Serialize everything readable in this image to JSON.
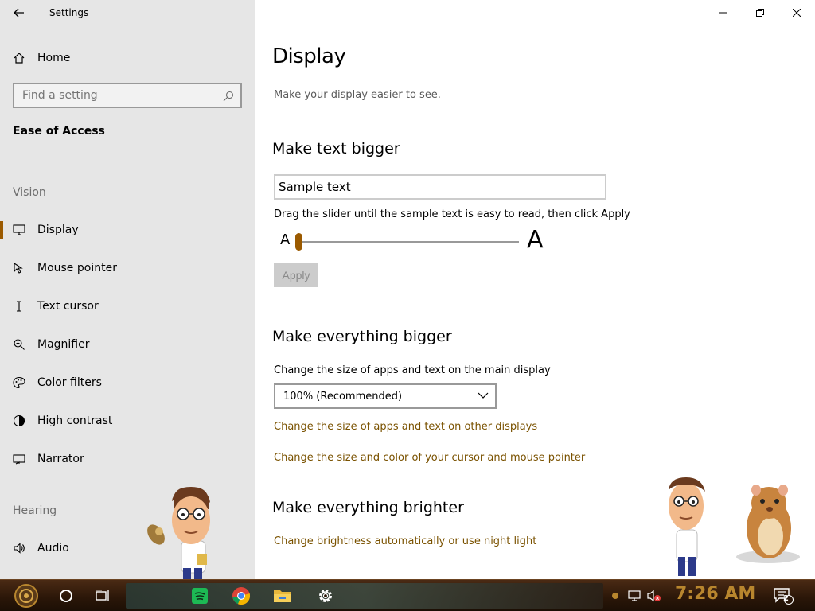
{
  "window": {
    "title": "Settings",
    "accent_color": "#9b5a00",
    "link_color": "#7a5200"
  },
  "sidebar": {
    "home_label": "Home",
    "search_placeholder": "Find a setting",
    "section_title": "Ease of Access",
    "groups": {
      "vision": "Vision",
      "hearing": "Hearing"
    },
    "items": [
      {
        "label": "Display",
        "icon": "monitor-icon",
        "selected": true
      },
      {
        "label": "Mouse pointer",
        "icon": "mouse-pointer-icon",
        "selected": false
      },
      {
        "label": "Text cursor",
        "icon": "text-cursor-icon",
        "selected": false
      },
      {
        "label": "Magnifier",
        "icon": "magnifier-icon",
        "selected": false
      },
      {
        "label": "Color filters",
        "icon": "color-filters-icon",
        "selected": false
      },
      {
        "label": "High contrast",
        "icon": "high-contrast-icon",
        "selected": false
      },
      {
        "label": "Narrator",
        "icon": "narrator-icon",
        "selected": false
      }
    ],
    "hearing_items": [
      {
        "label": "Audio",
        "icon": "audio-icon"
      }
    ]
  },
  "main": {
    "title": "Display",
    "subtitle": "Make your display easier to see.",
    "text_bigger": {
      "heading": "Make text bigger",
      "sample_text": "Sample text",
      "instruction": "Drag the slider until the sample text is easy to read, then click Apply",
      "slider_small_label": "A",
      "slider_large_label": "A",
      "slider_level": 0,
      "apply_label": "Apply"
    },
    "everything_bigger": {
      "heading": "Make everything bigger",
      "instruction": "Change the size of apps and text on the main display",
      "scale_value": "100% (Recommended)",
      "link_other_displays": "Change the size of apps and text on other displays",
      "link_cursor": "Change the size and color of your cursor and mouse pointer"
    },
    "everything_brighter": {
      "heading": "Make everything brighter",
      "link_brightness": "Change brightness automatically or use night light"
    }
  },
  "taskbar": {
    "clock": "7:26 AM",
    "notification_count": "2",
    "apps": [
      "start-icon",
      "cortana-icon",
      "task-view-icon",
      "spotify-icon",
      "chrome-icon",
      "file-explorer-icon",
      "settings-icon"
    ]
  }
}
